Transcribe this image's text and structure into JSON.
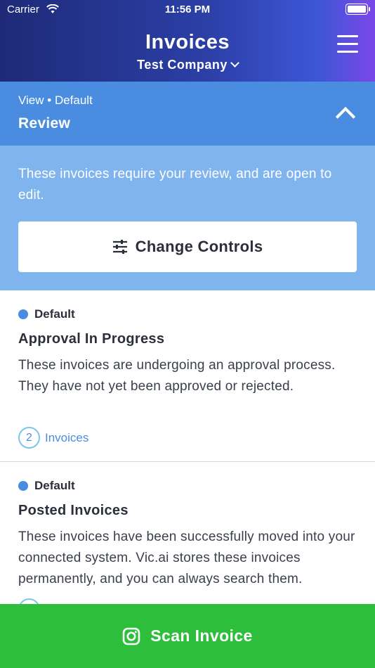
{
  "status": {
    "carrier": "Carrier",
    "time": "11:56 PM"
  },
  "header": {
    "title": "Invoices",
    "company": "Test Company"
  },
  "view": {
    "caption": "View • Default",
    "name": "Review"
  },
  "description": {
    "text": "These invoices require your review, and are open to edit.",
    "controls_label": "Change Controls"
  },
  "items": [
    {
      "tag": "Default",
      "title": "Approval In Progress",
      "description": "These invoices are undergoing an approval process. They have not yet been approved or rejected.",
      "count": "2",
      "count_label": "Invoices"
    },
    {
      "tag": "Default",
      "title": "Posted Invoices",
      "description": "These invoices have been successfully moved into your connected system. Vic.ai stores these invoices permanently, and you can always search them."
    }
  ],
  "scan": {
    "label": "Scan Invoice"
  },
  "colors": {
    "accent": "#4a8de0",
    "scan_green": "#2dbf3c",
    "panel": "#80b4ee"
  }
}
